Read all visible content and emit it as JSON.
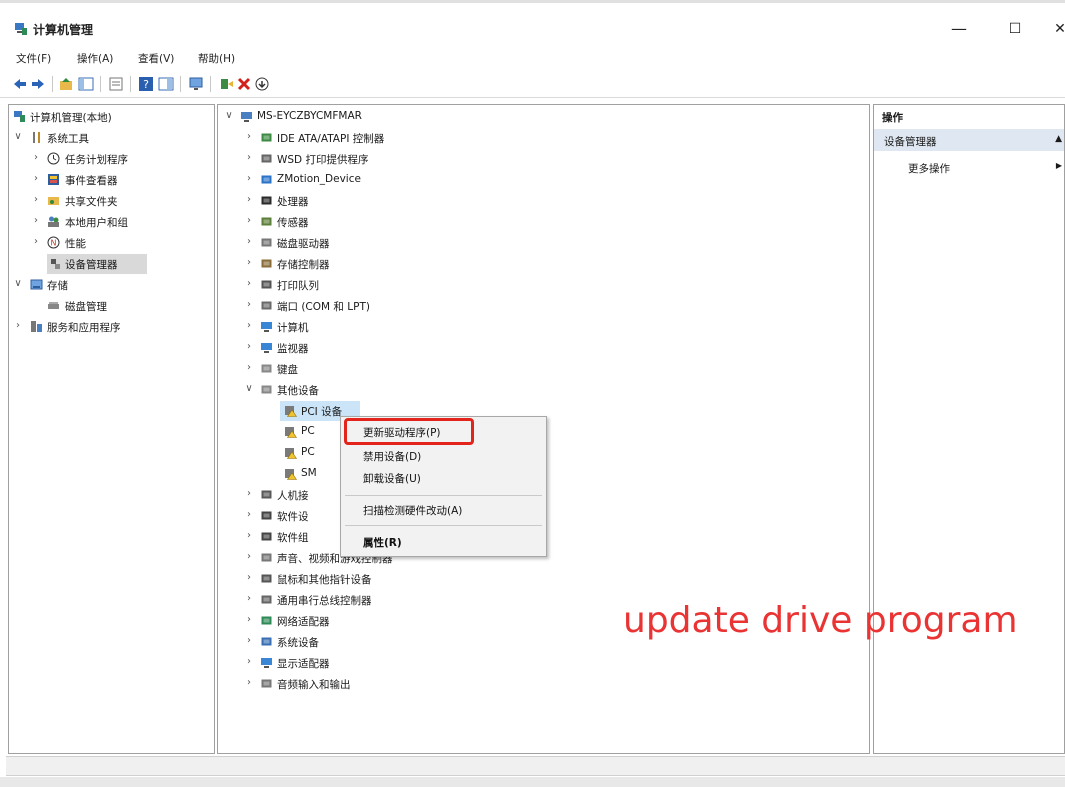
{
  "window": {
    "title": "计算机管理",
    "minimize": "—",
    "maximize": "☐",
    "close": "✕"
  },
  "menu": [
    "文件(F)",
    "操作(A)",
    "查看(V)",
    "帮助(H)"
  ],
  "left_tree": [
    {
      "label": "计算机管理(本地)",
      "expander": "",
      "icon": "computer-management-icon"
    },
    {
      "label": "系统工具",
      "expander": "∨",
      "icon": "tools-icon"
    },
    {
      "label": "任务计划程序",
      "expander": "›",
      "icon": "clock-icon"
    },
    {
      "label": "事件查看器",
      "expander": "›",
      "icon": "event-viewer-icon"
    },
    {
      "label": "共享文件夹",
      "expander": "›",
      "icon": "shared-folder-icon"
    },
    {
      "label": "本地用户和组",
      "expander": "›",
      "icon": "users-icon"
    },
    {
      "label": "性能",
      "expander": "›",
      "icon": "performance-icon"
    },
    {
      "label": "设备管理器",
      "expander": "",
      "icon": "device-manager-icon"
    },
    {
      "label": "存储",
      "expander": "∨",
      "icon": "storage-icon"
    },
    {
      "label": "磁盘管理",
      "expander": "",
      "icon": "disk-icon"
    },
    {
      "label": "服务和应用程序",
      "expander": "›",
      "icon": "services-icon"
    }
  ],
  "device_tree": [
    {
      "label": "MS-EYCZBYCMFMAR",
      "expander": "∨",
      "icon": "computer-icon"
    },
    {
      "label": "IDE ATA/ATAPI 控制器",
      "expander": "›",
      "icon": "ide-icon"
    },
    {
      "label": "WSD 打印提供程序",
      "expander": "›",
      "icon": "printer-icon"
    },
    {
      "label": "ZMotion_Device",
      "expander": "›",
      "icon": "zmotion-icon"
    },
    {
      "label": "处理器",
      "expander": "›",
      "icon": "processor-icon"
    },
    {
      "label": "传感器",
      "expander": "›",
      "icon": "sensor-icon"
    },
    {
      "label": "磁盘驱动器",
      "expander": "›",
      "icon": "disk-drive-icon"
    },
    {
      "label": "存储控制器",
      "expander": "›",
      "icon": "storage-controller-icon"
    },
    {
      "label": "打印队列",
      "expander": "›",
      "icon": "print-queue-icon"
    },
    {
      "label": "端口 (COM 和 LPT)",
      "expander": "›",
      "icon": "port-icon"
    },
    {
      "label": "计算机",
      "expander": "›",
      "icon": "monitor-icon"
    },
    {
      "label": "监视器",
      "expander": "›",
      "icon": "monitor-icon"
    },
    {
      "label": "键盘",
      "expander": "›",
      "icon": "keyboard-icon"
    },
    {
      "label": "其他设备",
      "expander": "∨",
      "icon": "other-devices-icon"
    },
    {
      "label": "PCI 设备",
      "expander": "",
      "icon": "warning-device-icon"
    },
    {
      "label": "PC",
      "expander": "",
      "icon": "warning-device-icon"
    },
    {
      "label": "PC",
      "expander": "",
      "icon": "warning-device-icon"
    },
    {
      "label": "SM",
      "expander": "",
      "icon": "warning-device-icon"
    },
    {
      "label": "人机接",
      "expander": "›",
      "icon": "hid-icon"
    },
    {
      "label": "软件设",
      "expander": "›",
      "icon": "software-device-icon"
    },
    {
      "label": "软件组",
      "expander": "›",
      "icon": "software-component-icon"
    },
    {
      "label": "声音、视频和游戏控制器",
      "expander": "›",
      "icon": "sound-icon"
    },
    {
      "label": "鼠标和其他指针设备",
      "expander": "›",
      "icon": "mouse-icon"
    },
    {
      "label": "通用串行总线控制器",
      "expander": "›",
      "icon": "usb-icon"
    },
    {
      "label": "网络适配器",
      "expander": "›",
      "icon": "network-icon"
    },
    {
      "label": "系统设备",
      "expander": "›",
      "icon": "system-device-icon"
    },
    {
      "label": "显示适配器",
      "expander": "›",
      "icon": "display-adapter-icon"
    },
    {
      "label": "音频输入和输出",
      "expander": "›",
      "icon": "audio-io-icon"
    }
  ],
  "context_menu": {
    "update_driver": "更新驱动程序(P)",
    "disable": "禁用设备(D)",
    "uninstall": "卸载设备(U)",
    "scan": "扫描检测硬件改动(A)",
    "properties": "属性(R)"
  },
  "actions_pane": {
    "header": "操作",
    "section": "设备管理器",
    "more": "更多操作",
    "collapse": "▲",
    "more_arrow": "▶"
  },
  "annotation": "update drive program",
  "colors": {
    "highlight": "#e3241b",
    "annotation": "#ea3434",
    "selection": "#dfe8f2"
  }
}
